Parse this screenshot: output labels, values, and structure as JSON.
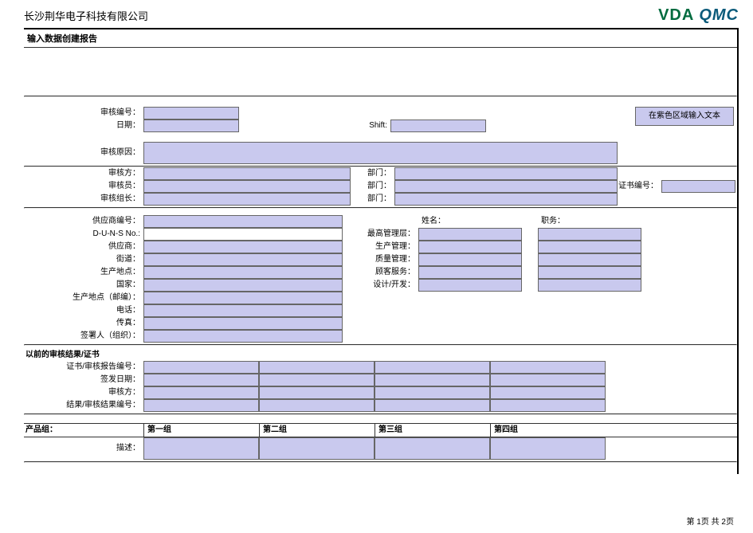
{
  "company_name": "长沙荆华电子科技有限公司",
  "logo": {
    "vda": "VDA",
    "qmc": "QMC"
  },
  "page_title": "输入数据创建报告",
  "hint_text": "在紫色区域输入文本",
  "labels": {
    "audit_no": "审核编号：",
    "date": "日期：",
    "shift": "Shift:",
    "audit_reason": "审核原因：",
    "audit_party": "审核方：",
    "auditor": "审核员：",
    "audit_team_leader": "审核组长：",
    "department": "部门：",
    "cert_no": "证书编号：",
    "supplier_no": "供应商编号：",
    "duns": "D-U-N-S No.:",
    "supplier": "供应商：",
    "street": "街道：",
    "prod_site": "生产地点：",
    "country": "国家：",
    "prod_site_zip": "生产地点（邮编）：",
    "phone": "电话：",
    "fax": "传真：",
    "signer_org": "签署人（组织）：",
    "name_col": "姓名：",
    "title_col": "职务：",
    "top_mgmt": "最高管理层：",
    "prod_mgmt": "生产管理：",
    "quality_mgmt": "质量管理：",
    "cust_service": "顾客服务：",
    "design_dev": "设计/开发：",
    "prev_section": "以前的审核结果/证书",
    "cert_report_no": "证书/审核报告编号：",
    "issue_date": "签发日期：",
    "audited_by": "审核方：",
    "result_no": "结果/审核结果编号：",
    "product_group": "产品组：",
    "group1": "第一组",
    "group2": "第二组",
    "group3": "第三组",
    "group4": "第四组",
    "description": "描述："
  },
  "footer": "第 1页 共 2页"
}
